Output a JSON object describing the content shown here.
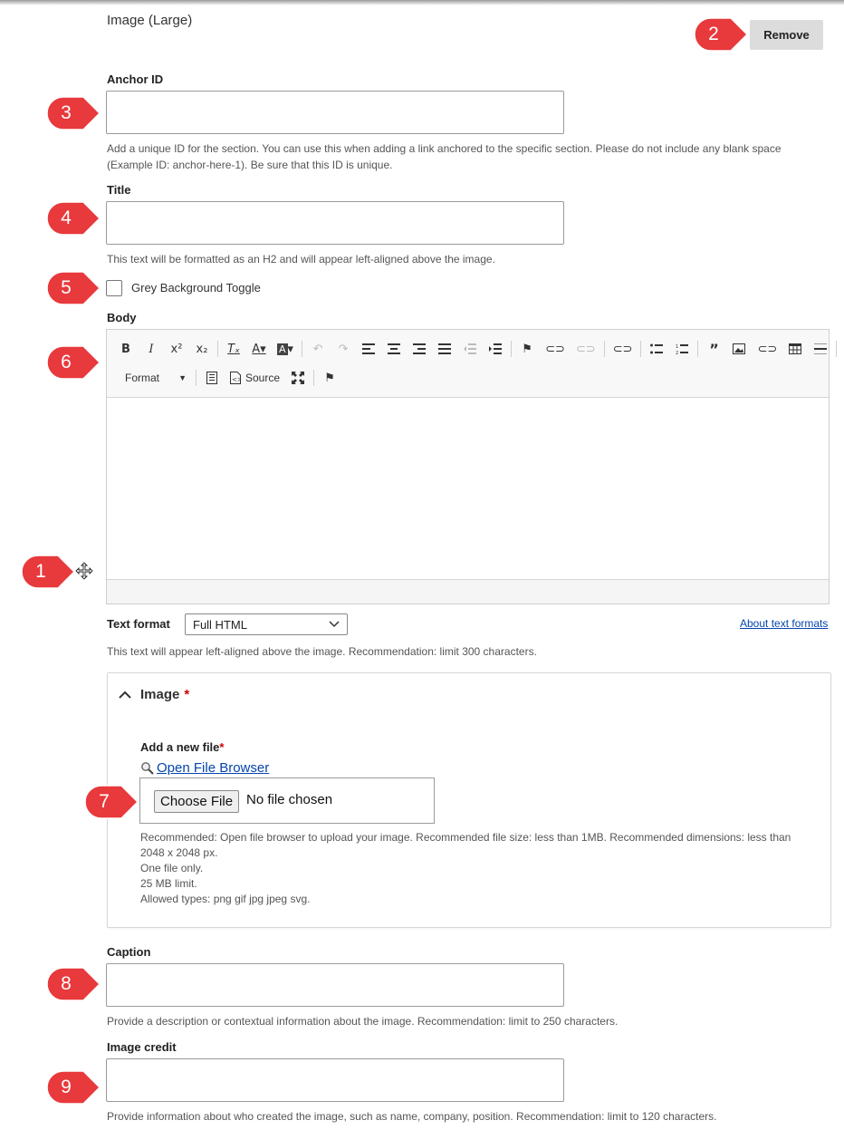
{
  "section": {
    "title": "Image (Large)",
    "remove_label": "Remove"
  },
  "anchor": {
    "label": "Anchor ID",
    "value": "",
    "description": "Add a unique ID for the section. You can use this when adding a link anchored to the specific section. Please do not include any blank space (Example ID: anchor-here-1). Be sure that this ID is unique."
  },
  "title_field": {
    "label": "Title",
    "value": "",
    "description": "This text will be formatted as an H2 and will appear left-aligned above the image."
  },
  "grey_toggle": {
    "label": "Grey Background Toggle",
    "checked": false
  },
  "body": {
    "label": "Body",
    "toolbar": {
      "format_label": "Format",
      "source_label": "Source",
      "icons": [
        "bold-icon",
        "italic-icon",
        "superscript-icon",
        "subscript-icon",
        "remove-format-icon",
        "text-color-icon",
        "background-color-icon",
        "undo-icon",
        "redo-icon",
        "align-left-icon",
        "align-center-icon",
        "align-right-icon",
        "justify-icon",
        "outdent-icon",
        "indent-icon",
        "anchor-flag-icon",
        "link-icon",
        "unlink-icon",
        "link-icon",
        "bulleted-list-icon",
        "numbered-list-icon",
        "blockquote-icon",
        "image-icon",
        "link-icon",
        "table-icon",
        "horizontal-rule-icon",
        "template-icon",
        "source-icon",
        "maximize-icon",
        "anchor-flag-icon"
      ]
    }
  },
  "text_format": {
    "label": "Text format",
    "selected": "Full HTML",
    "about_link": "About text formats",
    "description": "This text will appear left-aligned above the image. Recommendation: limit 300 characters."
  },
  "image": {
    "legend": "Image",
    "required_mark": "*",
    "add_label": "Add a new file",
    "browser_link": "Open File Browser",
    "choose_label": "Choose File",
    "no_file": "No file chosen",
    "help_1": "Recommended: Open file browser to upload your image. Recommended file size: less than 1MB. Recommended dimensions: less than 2048 x 2048 px.",
    "help_2": "One file only.",
    "help_3": "25 MB limit.",
    "help_4": "Allowed types: png gif jpg jpeg svg."
  },
  "caption": {
    "label": "Caption",
    "value": "",
    "description": "Provide a description or contextual information about the image. Recommendation: limit to 250 characters."
  },
  "credit": {
    "label": "Image credit",
    "value": "",
    "description": "Provide information about who created the image, such as name, company, position. Recommendation: limit to 120 characters."
  },
  "markers": [
    "1",
    "2",
    "3",
    "4",
    "5",
    "6",
    "7",
    "8",
    "9"
  ],
  "colors": {
    "marker_red": "#e8393c",
    "link_blue": "#0645ad",
    "required_red": "#cc0000"
  }
}
